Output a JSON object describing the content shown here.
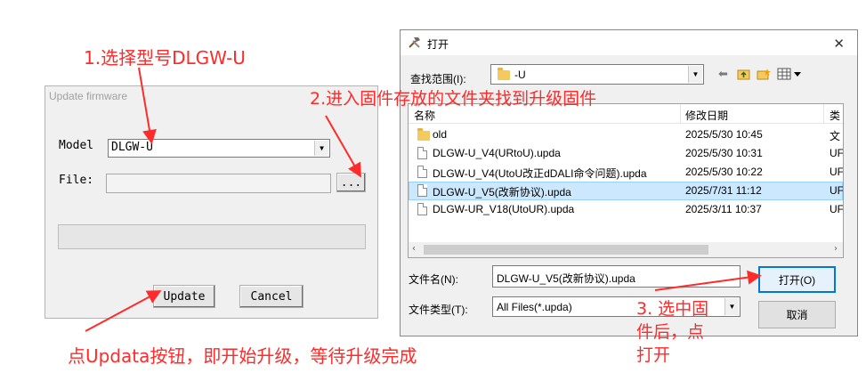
{
  "annotations": {
    "step1": "1.选择型号DLGW-U",
    "step2": "2.进入固件存放的文件夹找到升级固件",
    "step3_line1": "3. 选中固",
    "step3_line2": "件后，点",
    "step3_line3": "打开",
    "update_hint": "点Updata按钮，即开始升级，等待升级完成"
  },
  "firmware_dialog": {
    "title": "Update firmware",
    "model_label": "Model",
    "model_value": "DLGW-U",
    "file_label": "File:",
    "file_value": "",
    "browse_label": "...",
    "update_label": "Update",
    "cancel_label": "Cancel"
  },
  "open_dialog": {
    "title": "打开",
    "look_in_label": "查找范围(I):",
    "look_in_value": "-U",
    "columns": {
      "name": "名称",
      "date": "修改日期",
      "type": "类"
    },
    "files": [
      {
        "name": "old",
        "date": "2025/5/30 10:45",
        "type": "文",
        "kind": "folder"
      },
      {
        "name": "DLGW-U_V4(URtoU).updа",
        "date": "2025/5/30 10:31",
        "type": "UF",
        "kind": "file"
      },
      {
        "name": "DLGW-U_V4(UtoU改正dDALI命令问题).updа",
        "date": "2025/5/30 10:22",
        "type": "UF",
        "kind": "file"
      },
      {
        "name": "DLGW-U_V5(改新协议).updа",
        "date": "2025/7/31 11:12",
        "type": "UF",
        "kind": "file",
        "selected": true
      },
      {
        "name": "DLGW-UR_V18(UtoUR).updа",
        "date": "2025/3/11 10:37",
        "type": "UF",
        "kind": "file"
      }
    ],
    "filename_label": "文件名(N):",
    "filename_value": "DLGW-U_V5(改新协议).updа",
    "filetype_label": "文件类型(T):",
    "filetype_value": "All Files(*.updа)",
    "open_label": "打开(O)",
    "cancel_label": "取消"
  },
  "colors": {
    "annotation": "#ff2a2a",
    "selection": "#cce8ff"
  }
}
